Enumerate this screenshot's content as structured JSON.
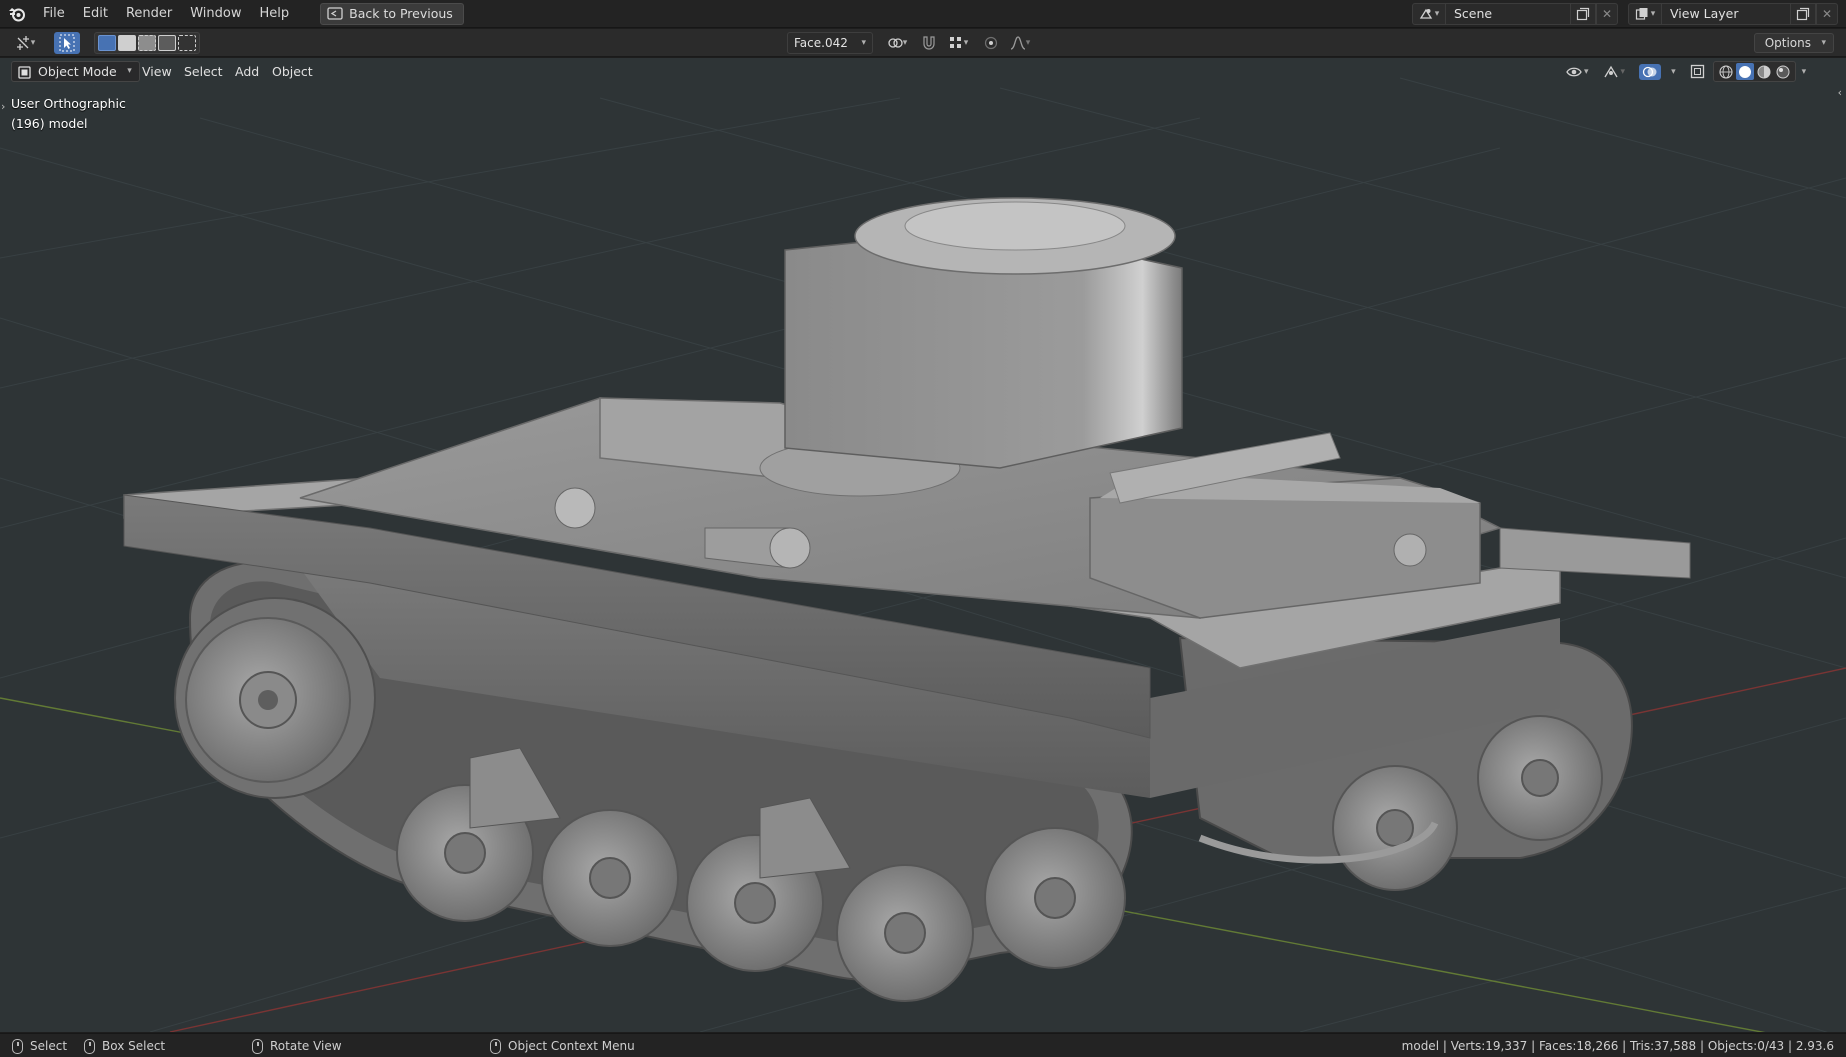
{
  "topbar": {
    "menus": [
      "File",
      "Edit",
      "Render",
      "Window",
      "Help"
    ],
    "back_label": "Back to Previous",
    "scene_name": "Scene",
    "view_layer_name": "View Layer"
  },
  "toolbar": {
    "orientation": "Face.042",
    "options_label": "Options"
  },
  "viewport": {
    "mode_label": "Object Mode",
    "menus": [
      "View",
      "Select",
      "Add",
      "Object"
    ],
    "view_name": "User Orthographic",
    "object_info": "(196) model"
  },
  "statusbar": {
    "select_label": "Select",
    "box_select_label": "Box Select",
    "rotate_label": "Rotate View",
    "context_menu_label": "Object Context Menu",
    "stats": "model | Verts:19,337 | Faces:18,266 | Tris:37,588 | Objects:0/43 | 2.93.6"
  },
  "colors": {
    "accent_blue": "#4772b3",
    "viewport_bg": "#2e3436",
    "grid_line": "#3a4143",
    "x_axis": "#8a3a3a",
    "y_axis": "#6b8a2a",
    "model_gray": "#8c8c8c"
  },
  "icons": {
    "logo": "blender-logo-icon",
    "editor_type": "3d-viewport-icon",
    "cursor_tool": "select-cursor-icon"
  }
}
